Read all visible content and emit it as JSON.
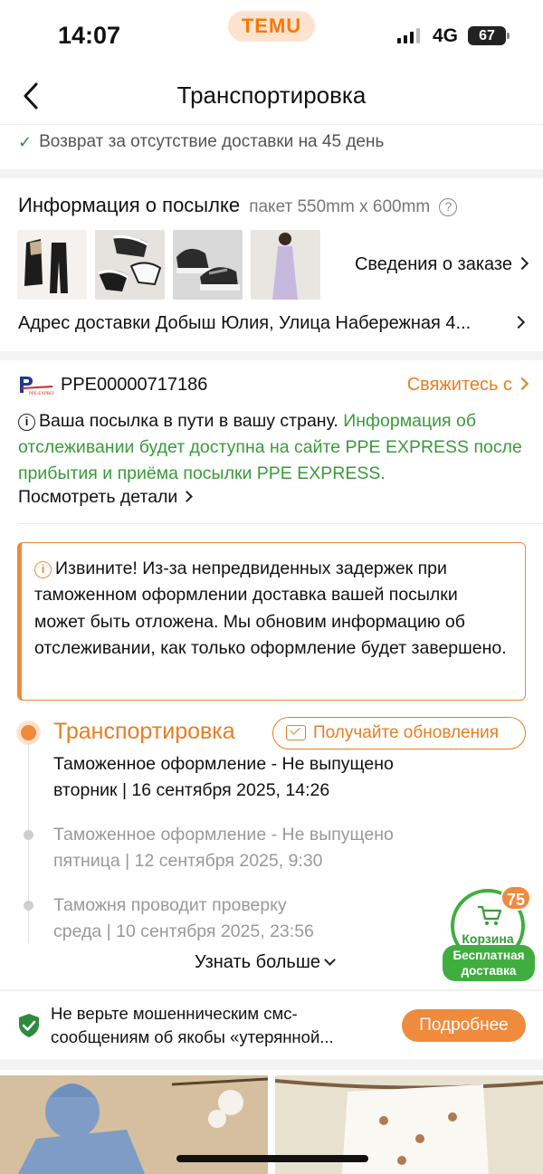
{
  "status_bar": {
    "time": "14:07",
    "brand": "TEMU",
    "network": "4G",
    "battery": "67"
  },
  "nav": {
    "title": "Транспортировка"
  },
  "return_policy": "Возврат за отсутствие доставки на 45 день",
  "package": {
    "title": "Информация о посылке",
    "size": "пакет 550mm x 600mm",
    "help_icon": "?",
    "order_details_link": "Сведения о заказе",
    "address": "Адрес доставки Добыш Юлия, Улица Набережная 4..."
  },
  "carrier": {
    "tracking_number": "PPE00000717186",
    "contact_link": "Свяжитесь с",
    "transit_note": "Ваша посылка в пути в вашу страну.",
    "tracking_note": "Информация об отслеживании будет доступна на сайте PPE EXPRESS после прибытия и приёма посылки PPE EXPRESS.",
    "view_details": "Посмотреть детали"
  },
  "warning": {
    "text": "Извините! Из-за непредвиденных задержек при таможенном оформлении доставка вашей посылки может быть отложена. Мы обновим информацию об отслеживании, как только оформление будет завершено."
  },
  "timeline": {
    "status": "Транспортировка",
    "updates_button": "Получайте обновления",
    "events": [
      {
        "title": "Таможенное оформление - Не выпущено",
        "date": "вторник | 16 сентября 2025, 14:26"
      },
      {
        "title": "Таможенное оформление - Не выпущено",
        "date": "пятница | 12 сентября 2025, 9:30"
      },
      {
        "title": "Таможня проводит проверку",
        "date": "среда | 10 сентября 2025, 23:56"
      }
    ],
    "more_link": "Узнать больше"
  },
  "cart": {
    "label": "Корзина",
    "count": "75",
    "free_shipping": "Бесплатная доставка"
  },
  "scam_notice": {
    "text": "Не верьте мошенническим смс-сообщениям об якобы «утерянной...",
    "button": "Подробнее"
  },
  "colors": {
    "accent": "#F08A3C",
    "green": "#3A9A3A",
    "brand_bg": "#FDE3CF"
  }
}
